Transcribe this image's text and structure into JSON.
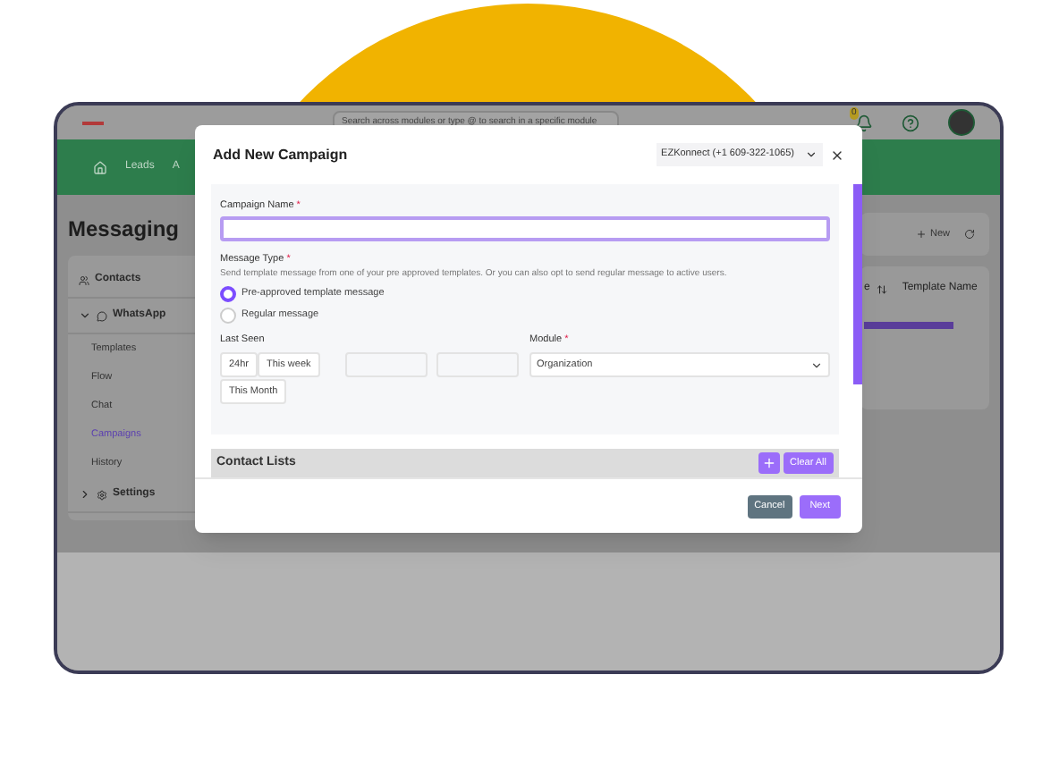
{
  "topbar": {
    "search_placeholder": "Search across modules or type @ to search in a specific module",
    "notification_count": "0"
  },
  "nav": {
    "items": [
      "Leads",
      "A"
    ]
  },
  "sidebar": {
    "title": "Messaging",
    "items": [
      {
        "kind": "link",
        "label": "Contacts"
      },
      {
        "kind": "group",
        "label": "WhatsApp",
        "expanded": true,
        "children": [
          {
            "label": "Templates",
            "selected": false
          },
          {
            "label": "Flow",
            "selected": false
          },
          {
            "label": "Chat",
            "selected": false
          },
          {
            "label": "Campaigns",
            "selected": true
          },
          {
            "label": "History",
            "selected": false
          }
        ]
      },
      {
        "kind": "group",
        "label": "Settings",
        "expanded": false
      }
    ]
  },
  "main": {
    "new_button": "New",
    "columns": [
      "e",
      "Template Name"
    ]
  },
  "modal": {
    "title": "Add New Campaign",
    "account": "EZKonnect (+1 609-322-1065)",
    "campaign_name": {
      "label": "Campaign Name",
      "required_mark": "*",
      "focused": true
    },
    "message_type": {
      "label": "Message Type",
      "required_mark": "*",
      "description": "Send template message from one of your pre approved templates. Or you can also opt to send regular message to active users.",
      "options": [
        {
          "label": "Pre-approved template message",
          "selected": true
        },
        {
          "label": "Regular message",
          "selected": false
        }
      ]
    },
    "last_seen": {
      "label": "Last Seen",
      "presets": [
        {
          "label": "24hr",
          "selected": false
        },
        {
          "label": "This week",
          "selected": false
        },
        {
          "label": "This Month",
          "selected": false
        }
      ]
    },
    "module": {
      "label": "Module",
      "required_mark": "*",
      "value": "Organization"
    },
    "contact_lists": {
      "title": "Contact Lists",
      "clear_button": "Clear All"
    },
    "buttons": {
      "cancel": "Cancel",
      "next": "Next"
    }
  }
}
